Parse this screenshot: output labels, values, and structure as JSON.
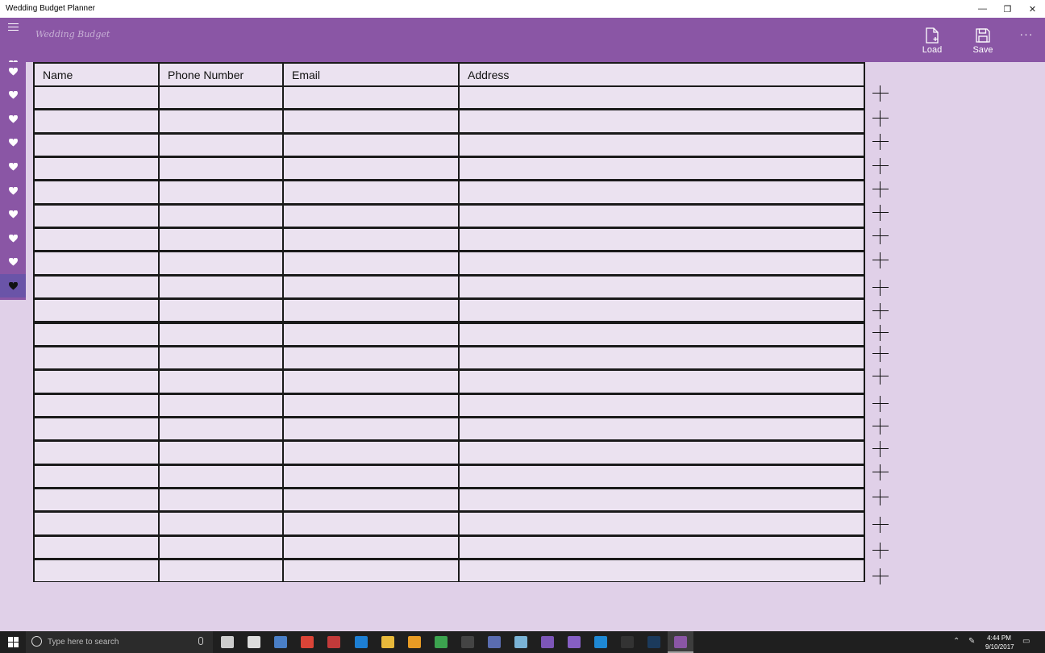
{
  "window": {
    "title": "Wedding Budget Planner",
    "minimize_icon": "—",
    "restore_icon": "❐",
    "close_icon": "✕"
  },
  "appbar": {
    "brand": "Wedding Budget",
    "load_label": "Load",
    "save_label": "Save",
    "more_label": "···",
    "color": "#8a56a5"
  },
  "nav": {
    "icon": "heart-icon",
    "item_count": 10,
    "active_index": 9
  },
  "table": {
    "headers": [
      "Name",
      "Phone Number",
      "Email",
      "Address"
    ],
    "row_count": 21,
    "cell_color": "#ebe2f0"
  },
  "taskbar": {
    "search_placeholder": "Type here to search",
    "time": "4:44 PM",
    "date": "9/10/2017"
  }
}
